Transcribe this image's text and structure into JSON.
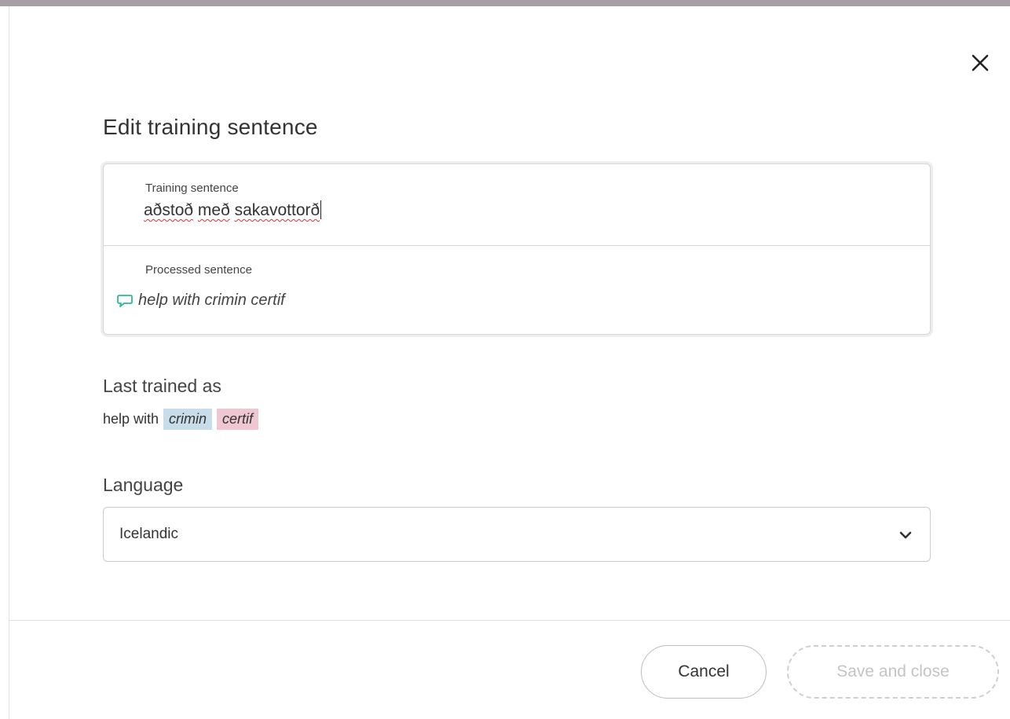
{
  "dialog": {
    "title": "Edit training sentence",
    "close_icon": "close-icon"
  },
  "training": {
    "label": "Training sentence",
    "words": [
      "aðstoð",
      "með",
      "sakavottorð"
    ],
    "value": "aðstoð með sakavottorð"
  },
  "processed": {
    "label": "Processed sentence",
    "icon": "speech-bubble-icon",
    "icon_color": "#2bb89a",
    "text": "help with crimin certif"
  },
  "last_trained": {
    "heading": "Last trained as",
    "plain": "help with",
    "tags": [
      {
        "text": "crimin",
        "color": "#c8dcea"
      },
      {
        "text": "certif",
        "color": "#efc7d3"
      }
    ]
  },
  "language": {
    "heading": "Language",
    "selected": "Icelandic",
    "icon": "chevron-down-icon"
  },
  "footer": {
    "cancel_label": "Cancel",
    "save_label": "Save and close"
  }
}
